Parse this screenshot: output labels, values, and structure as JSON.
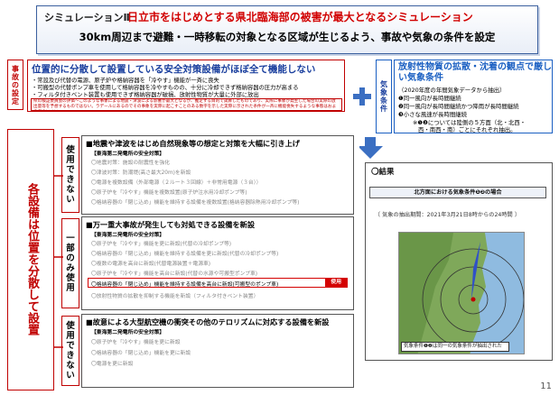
{
  "header": {
    "simulation_label": "シミュレーションⅡ",
    "title": "日立市をはじめとする県北臨海部の被害が最大となるシミュレーション",
    "subtitle": "30km周辺まで避難・一時移転の対象となる区域が生じるよう、事故や気象の条件を設定"
  },
  "accident": {
    "side_label": "事故の設定",
    "title": "位置的に分散して設置している安全対策設備がほぼ全て機能しない",
    "bullets": [
      "・常設及び代替の電源、原子炉や格納容器を「冷やす」機能が一斉に喪失",
      "・可搬型の代替ポンプ車を使用して格納容器を冷やすものの、十分に冷却できず格納容器の圧力が高まる",
      "・フィルタ付きベント装置も使用できず格納容器が破損、放射性物質が大量に外部に放出"
    ],
    "note": "県の検証委員会の評価～このような事象による地震・津波による影響が最大となるが、推定する目的で試算したものであり、実際に事象が発生した場合の実際の放出量等を予想するものではない。ラデールにあるのでその事象を実際に起こすことのある数字を示した実際に示された条件が一斉に機能喪失するような事態はおよそ考えにくい"
  },
  "weather": {
    "side_label": "気象条件",
    "title": "放射性物質の拡散・沈着の観点で厳しい気象条件",
    "lines": [
      "（2020年度の年間気象データから抽出）",
      "❶同一風向が長時間継続",
      "❷同一風向が長時間継続かつ降雨が長時間継続",
      "❸小さな風速が長時間継続",
      "※❶❷については陸側の５方面（北・北西・",
      "西・南西・南）ごとにそれぞれ抽出。"
    ]
  },
  "big_label": "各設備は位置を分散して設置",
  "sections": [
    {
      "category": "使用できない",
      "title": "■地震や津波をはじめ自然現象等の想定と対策を大幅に引き上げ",
      "heading": "【東海第二発電所の安全対策】",
      "items": [
        "〇地震対策：施設の耐震性を強化",
        "〇津波対策：防潮堤(高さ最大20m)を新設",
        "〇電源を複数設備（外部電源（２ルート３回線）＋非常用電源（３台））",
        "〇原子炉を「冷やす」機能を複数設置(原子炉注水用冷却ポンプ等)",
        "〇格納容器の「閉じ込め」機能を維持する設備を複数設置(格納容器除熱用冷却ポンプ等)"
      ]
    },
    {
      "category": "一部のみ使用",
      "title": "■万一重大事故が発生しても対処できる設備を新設",
      "heading": "【東海第二発電所の安全対策】",
      "items": [
        "〇原子炉を「冷やす」機能を更に新設(代替の冷却ポンプ等)",
        "〇格納容器の「閉じ込め」機能を維持する設備を更に新設(代替の冷却ポンプ等)",
        "〇複数の電源を高台に新設(代替電源装置＋電源車)",
        "〇原子炉を「冷やす」機能を高台に新設(代替の水源や可搬型ポンプ車)",
        "〇格納容器の「閉じ込め」機能を維持する設備を高台に新設(可搬型のポンプ車)",
        "〇放射性物質の拡散を抑制する機能を新設（フィルタ付きベント装置）"
      ],
      "used_tag": "使用"
    },
    {
      "category": "使用できない",
      "title": "■故意による大型航空機の衝突その他のテロリズムに対応する設備を新設",
      "heading": "【東海第二発電所の安全対策】",
      "items": [
        "〇原子炉を「冷やす」機能を更に新設",
        "〇格納容器の「閉じ込め」機能を更に新設",
        "〇電源を更に新設"
      ]
    }
  ],
  "result": {
    "title": "〇結果",
    "subtitle": "北方面における気象条件❶❷の場合",
    "date": "〔 気象の抽出期間：2021年3月21日8時からの24時間 〕",
    "map_caption": "気象条件❶❷は同一の気象条件が抽出された"
  },
  "page_number": "11",
  "colors": {
    "accent_red": "#c00000",
    "accent_blue": "#1a3f9e",
    "plus": "#3b6fc2"
  }
}
